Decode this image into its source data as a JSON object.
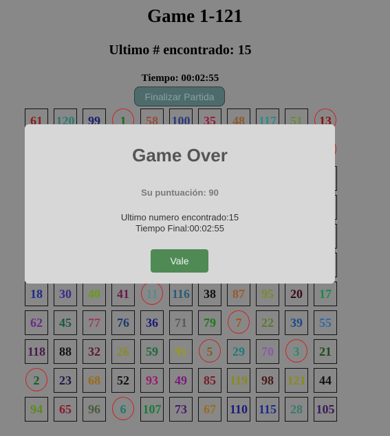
{
  "header": {
    "title": "Game 1-121",
    "last_found": "Ultimo # encontrado: 15",
    "timer": "Tiempo: 00:02:55",
    "finish_button": "Finalizar Partida"
  },
  "colors": {
    "background": "#888888",
    "found_circle": "#cc2222",
    "modal_bg": "#d7d7d7",
    "accept_button": "#4f8a55",
    "finish_button": "#4d6b6b"
  },
  "grid": {
    "columns": 11,
    "rows": [
      {
        "row": 0,
        "cells": [
          {
            "n": "61",
            "c": "#8b1e1e",
            "f": false
          },
          {
            "n": "120",
            "c": "#2a7a6e",
            "f": false
          },
          {
            "n": "99",
            "c": "#1c1c6e",
            "f": false
          },
          {
            "n": "1",
            "c": "#1e6b1e",
            "f": true
          },
          {
            "n": "58",
            "c": "#9a4a3a",
            "f": false
          },
          {
            "n": "100",
            "c": "#2a3a7a",
            "f": false
          },
          {
            "n": "35",
            "c": "#9a1a3a",
            "f": false
          },
          {
            "n": "48",
            "c": "#8a5a2a",
            "f": false
          },
          {
            "n": "117",
            "c": "#2a8a8a",
            "f": false
          },
          {
            "n": "51",
            "c": "#6a8a3a",
            "f": false
          },
          {
            "n": "13",
            "c": "#8b1010",
            "f": true
          }
        ]
      },
      {
        "row": 1,
        "cells": [
          {
            "n": "",
            "c": "#000",
            "f": false
          },
          {
            "n": "",
            "c": "#000",
            "f": false
          },
          {
            "n": "",
            "c": "#000",
            "f": false
          },
          {
            "n": "",
            "c": "#000",
            "f": false
          },
          {
            "n": "",
            "c": "#000",
            "f": false
          },
          {
            "n": "",
            "c": "#000",
            "f": false
          },
          {
            "n": "",
            "c": "#000",
            "f": false
          },
          {
            "n": "",
            "c": "#000",
            "f": false
          },
          {
            "n": "",
            "c": "#000",
            "f": false
          },
          {
            "n": "",
            "c": "#000",
            "f": false
          },
          {
            "n": "",
            "c": "#000",
            "f": true
          }
        ]
      },
      {
        "row": 2,
        "cells": [
          {
            "n": "",
            "c": "#000",
            "f": false
          },
          {
            "n": "",
            "c": "#000",
            "f": false
          },
          {
            "n": "",
            "c": "#000",
            "f": false
          },
          {
            "n": "",
            "c": "#000",
            "f": false
          },
          {
            "n": "",
            "c": "#000",
            "f": false
          },
          {
            "n": "",
            "c": "#000",
            "f": false
          },
          {
            "n": "",
            "c": "#000",
            "f": false
          },
          {
            "n": "",
            "c": "#000",
            "f": false
          },
          {
            "n": "",
            "c": "#000",
            "f": false
          },
          {
            "n": "",
            "c": "#000",
            "f": false
          },
          {
            "n": "",
            "c": "#000",
            "f": false
          }
        ]
      },
      {
        "row": 3,
        "cells": [
          {
            "n": "",
            "c": "#000",
            "f": false
          },
          {
            "n": "",
            "c": "#000",
            "f": false
          },
          {
            "n": "",
            "c": "#000",
            "f": false
          },
          {
            "n": "",
            "c": "#000",
            "f": false
          },
          {
            "n": "",
            "c": "#000",
            "f": false
          },
          {
            "n": "",
            "c": "#000",
            "f": false
          },
          {
            "n": "",
            "c": "#000",
            "f": false
          },
          {
            "n": "",
            "c": "#000",
            "f": false
          },
          {
            "n": "",
            "c": "#000",
            "f": false
          },
          {
            "n": "",
            "c": "#000",
            "f": false
          },
          {
            "n": "",
            "c": "#000",
            "f": false
          }
        ]
      },
      {
        "row": 4,
        "cells": [
          {
            "n": "",
            "c": "#000",
            "f": false
          },
          {
            "n": "",
            "c": "#000",
            "f": false
          },
          {
            "n": "",
            "c": "#000",
            "f": false
          },
          {
            "n": "",
            "c": "#000",
            "f": false
          },
          {
            "n": "",
            "c": "#000",
            "f": false
          },
          {
            "n": "",
            "c": "#000",
            "f": false
          },
          {
            "n": "",
            "c": "#000",
            "f": false
          },
          {
            "n": "",
            "c": "#000",
            "f": false
          },
          {
            "n": "",
            "c": "#000",
            "f": false
          },
          {
            "n": "",
            "c": "#000",
            "f": false
          },
          {
            "n": "",
            "c": "#000",
            "f": false
          }
        ]
      },
      {
        "row": 5,
        "cells": [
          {
            "n": "",
            "c": "#000",
            "f": false
          },
          {
            "n": "",
            "c": "#000",
            "f": false
          },
          {
            "n": "",
            "c": "#000",
            "f": false
          },
          {
            "n": "",
            "c": "#000",
            "f": false
          },
          {
            "n": "",
            "c": "#000",
            "f": false
          },
          {
            "n": "",
            "c": "#000",
            "f": false
          },
          {
            "n": "",
            "c": "#000",
            "f": false
          },
          {
            "n": "",
            "c": "#000",
            "f": false
          },
          {
            "n": "",
            "c": "#000",
            "f": false
          },
          {
            "n": "",
            "c": "#000",
            "f": false
          },
          {
            "n": "",
            "c": "#000",
            "f": false
          }
        ]
      },
      {
        "row": 6,
        "cells": [
          {
            "n": "18",
            "c": "#1f2a8a",
            "f": false
          },
          {
            "n": "30",
            "c": "#3a2a8a",
            "f": false
          },
          {
            "n": "40",
            "c": "#6a9a1a",
            "f": false
          },
          {
            "n": "41",
            "c": "#6a1a4a",
            "f": false
          },
          {
            "n": "11",
            "c": "#5a8a8a",
            "f": true
          },
          {
            "n": "116",
            "c": "#2a5a7a",
            "f": false
          },
          {
            "n": "38",
            "c": "#111",
            "f": false
          },
          {
            "n": "87",
            "c": "#9a5a2a",
            "f": false
          },
          {
            "n": "95",
            "c": "#7a8a2a",
            "f": false
          },
          {
            "n": "20",
            "c": "#3a0a1a",
            "f": false
          },
          {
            "n": "17",
            "c": "#1a8a4a",
            "f": false
          }
        ]
      },
      {
        "row": 7,
        "cells": [
          {
            "n": "62",
            "c": "#6a2a8a",
            "f": false
          },
          {
            "n": "45",
            "c": "#1a5a3a",
            "f": false
          },
          {
            "n": "77",
            "c": "#9a3a6a",
            "f": false
          },
          {
            "n": "76",
            "c": "#1a3a6a",
            "f": false
          },
          {
            "n": "36",
            "c": "#1a1a7a",
            "f": false
          },
          {
            "n": "71",
            "c": "#5a5a5a",
            "f": false
          },
          {
            "n": "79",
            "c": "#1a7a1a",
            "f": false
          },
          {
            "n": "7",
            "c": "#9a5a1a",
            "f": true
          },
          {
            "n": "22",
            "c": "#5a7a2a",
            "f": false
          },
          {
            "n": "39",
            "c": "#1a4a8a",
            "f": false
          },
          {
            "n": "55",
            "c": "#2a6aaa",
            "f": false
          }
        ]
      },
      {
        "row": 8,
        "cells": [
          {
            "n": "118",
            "c": "#4a1a4a",
            "f": false
          },
          {
            "n": "88",
            "c": "#111",
            "f": false
          },
          {
            "n": "32",
            "c": "#5a1a2a",
            "f": false
          },
          {
            "n": "26",
            "c": "#8a8a2a",
            "f": false
          },
          {
            "n": "59",
            "c": "#1a6a3a",
            "f": false
          },
          {
            "n": "91",
            "c": "#9a9a1a",
            "f": false
          },
          {
            "n": "5",
            "c": "#8a5a1a",
            "f": true
          },
          {
            "n": "29",
            "c": "#1a7a7a",
            "f": false
          },
          {
            "n": "70",
            "c": "#8a5aaa",
            "f": false
          },
          {
            "n": "3",
            "c": "#2a8a6a",
            "f": true
          },
          {
            "n": "21",
            "c": "#1a4a1a",
            "f": false
          }
        ]
      },
      {
        "row": 9,
        "cells": [
          {
            "n": "2",
            "c": "#1a5a2a",
            "f": true
          },
          {
            "n": "23",
            "c": "#1a1a4a",
            "f": false
          },
          {
            "n": "68",
            "c": "#9a6a1a",
            "f": false
          },
          {
            "n": "52",
            "c": "#111",
            "f": false
          },
          {
            "n": "93",
            "c": "#9a1a6a",
            "f": false
          },
          {
            "n": "49",
            "c": "#7a1a7a",
            "f": false
          },
          {
            "n": "85",
            "c": "#7a1a2a",
            "f": false
          },
          {
            "n": "119",
            "c": "#8a8a1a",
            "f": false
          },
          {
            "n": "98",
            "c": "#4a1a1a",
            "f": false
          },
          {
            "n": "121",
            "c": "#8a8a1a",
            "f": false
          },
          {
            "n": "44",
            "c": "#111",
            "f": false
          }
        ]
      },
      {
        "row": 10,
        "cells": [
          {
            "n": "94",
            "c": "#5a8a1a",
            "f": false
          },
          {
            "n": "65",
            "c": "#8a1a2a",
            "f": false
          },
          {
            "n": "96",
            "c": "#4a5a3a",
            "f": false
          },
          {
            "n": "6",
            "c": "#1a7a6a",
            "f": true
          },
          {
            "n": "107",
            "c": "#1a7a3a",
            "f": false
          },
          {
            "n": "73",
            "c": "#4a1a6a",
            "f": false
          },
          {
            "n": "67",
            "c": "#9a6a1a",
            "f": false
          },
          {
            "n": "110",
            "c": "#1a1a7a",
            "f": false
          },
          {
            "n": "115",
            "c": "#1a2a8a",
            "f": false
          },
          {
            "n": "28",
            "c": "#3a7a6a",
            "f": false
          },
          {
            "n": "105",
            "c": "#3a1a5a",
            "f": false
          }
        ]
      }
    ]
  },
  "modal": {
    "title": "Game Over",
    "score": "Su puntuación: 90",
    "last_number": "Ultimo numero encontrado:15",
    "final_time": "Tiempo Final:00:02:55",
    "accept_button": "Vale"
  }
}
